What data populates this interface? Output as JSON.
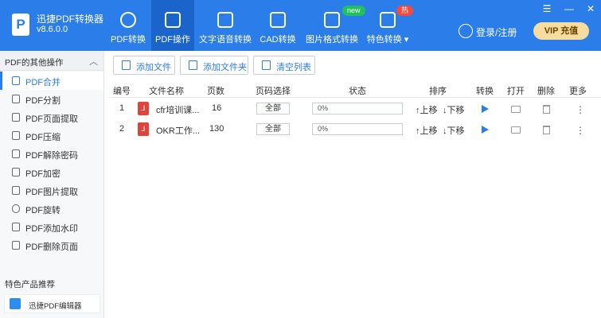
{
  "app": {
    "title": "迅捷PDF转换器",
    "version": "v8.6.0.0",
    "logo_letter": "P"
  },
  "window_controls": {
    "menu": "☰",
    "minimize": "—",
    "close": "✕"
  },
  "nav": [
    {
      "label": "PDF转换",
      "active": false
    },
    {
      "label": "PDF操作",
      "active": true
    },
    {
      "label": "文字语音转换",
      "active": false
    },
    {
      "label": "CAD转换",
      "active": false
    },
    {
      "label": "图片格式转换",
      "active": false,
      "badge": "new"
    },
    {
      "label": "特色转换 ▾",
      "active": false,
      "badge": "热"
    }
  ],
  "user": {
    "login": "登录/注册",
    "vip": "VIP 充值"
  },
  "sidebar": {
    "header": "PDF的其他操作",
    "collapse": "︿",
    "items": [
      {
        "label": "PDF合并",
        "active": true
      },
      {
        "label": "PDF分割"
      },
      {
        "label": "PDF页面提取"
      },
      {
        "label": "PDF压缩"
      },
      {
        "label": "PDF解除密码"
      },
      {
        "label": "PDF加密"
      },
      {
        "label": "PDF图片提取"
      },
      {
        "label": "PDF旋转"
      },
      {
        "label": "PDF添加水印"
      },
      {
        "label": "PDF删除页面"
      }
    ],
    "featured_title": "特色产品推荐",
    "featured_item": "迅捷PDF编辑器"
  },
  "toolbar": {
    "add_file": "添加文件",
    "add_folder": "添加文件夹",
    "clear_list": "清空列表"
  },
  "table": {
    "headers": [
      "编号",
      "文件名称",
      "页数",
      "页码选择",
      "状态",
      "排序",
      "转换",
      "打开",
      "删除",
      "更多"
    ],
    "rows": [
      {
        "index": "1",
        "name": "cfr培训课...",
        "pages": "16",
        "range": "全部",
        "progress": 0,
        "status": "0%",
        "up": "↑上移",
        "down": "↓下移"
      },
      {
        "index": "2",
        "name": "OKR工作...",
        "pages": "130",
        "range": "全部",
        "progress": 0,
        "status": "0%",
        "up": "↑上移",
        "down": "↓下移"
      }
    ]
  },
  "icons": {
    "more": "⋮",
    "pdf": "⅃"
  }
}
